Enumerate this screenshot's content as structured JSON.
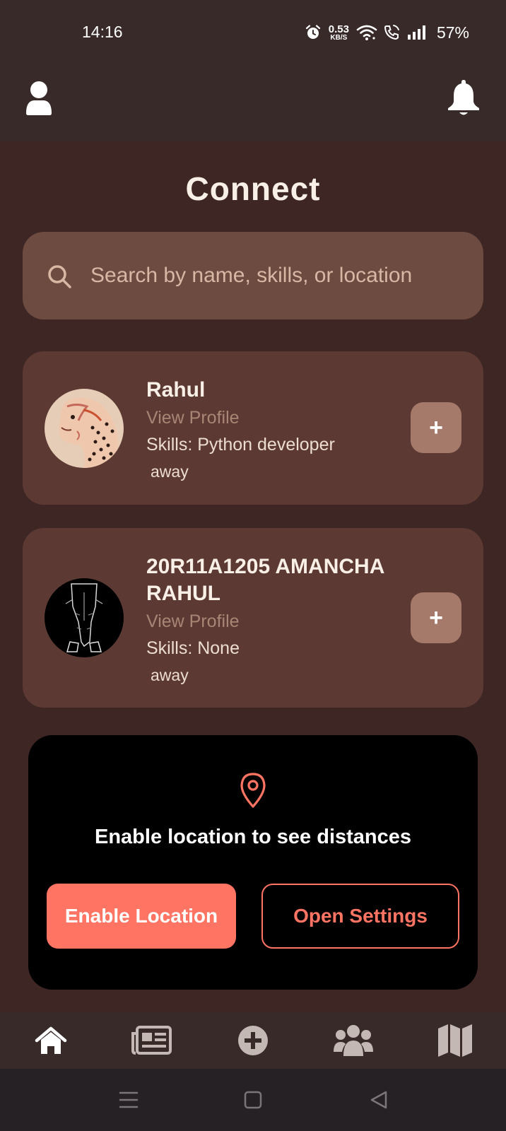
{
  "status_bar": {
    "time": "14:16",
    "net_speed_value": "0.53",
    "net_speed_unit": "KB/S",
    "battery": "57%",
    "icons": [
      "alarm-icon",
      "wifi-icon",
      "wifi-calling-icon",
      "signal-icon"
    ]
  },
  "header": {
    "profile_icon": "user-icon",
    "notifications_icon": "bell-icon"
  },
  "page": {
    "title": "Connect"
  },
  "search": {
    "placeholder": "Search by name, skills, or location",
    "value": ""
  },
  "users": [
    {
      "name": "Rahul",
      "view_profile": "View Profile",
      "skills": "Skills: Python developer",
      "distance": "away",
      "avatar": "cheetah-illustration"
    },
    {
      "name": "20R11A1205 AMANCHA RAHUL",
      "view_profile": "View Profile",
      "skills": "Skills: None",
      "distance": "away",
      "avatar": "person-sketch"
    }
  ],
  "location_prompt": {
    "message": "Enable location to see distances",
    "enable_label": "Enable Location",
    "settings_label": "Open Settings"
  },
  "bottom_nav": {
    "items": [
      "home-icon",
      "news-icon",
      "add-circle-icon",
      "users-icon",
      "map-icon"
    ]
  },
  "system_nav": [
    "menu-icon",
    "home-square-icon",
    "back-icon"
  ],
  "colors": {
    "background": "#3d2624",
    "header": "#392a2a",
    "card": "#5c3a33",
    "search": "#6d4b41",
    "accent": "#ff7462",
    "add_button": "#a57a6b"
  }
}
